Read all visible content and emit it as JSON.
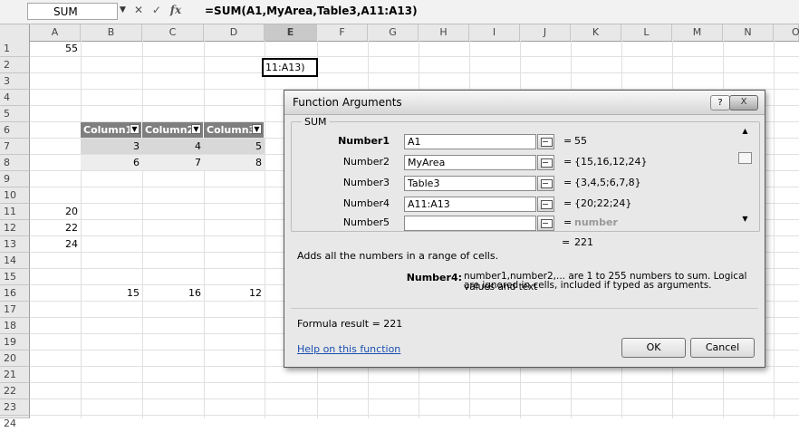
{
  "name_box": "SUM",
  "formula_bar": {
    "cancel_glyph": "✕",
    "enter_glyph": "✓",
    "fx_label": "fx",
    "formula": "=SUM(A1,MyArea,Table3,A11:A13)"
  },
  "columns": [
    "A",
    "B",
    "C",
    "D",
    "E",
    "F",
    "G",
    "H",
    "I",
    "J",
    "K",
    "L",
    "M",
    "N",
    "O"
  ],
  "rows": [
    "1",
    "2",
    "3",
    "4",
    "5",
    "6",
    "7",
    "8",
    "9",
    "10",
    "11",
    "12",
    "13",
    "14",
    "15",
    "16",
    "17",
    "18",
    "19",
    "20",
    "21",
    "22",
    "23",
    "24"
  ],
  "cells": {
    "A1": "55",
    "E2_edit": "11:A13)",
    "A11": "20",
    "A12": "22",
    "A13": "24",
    "B16": "15",
    "C16": "16",
    "D16": "12"
  },
  "table": {
    "headers": [
      "Column1",
      "Column2",
      "Column3"
    ],
    "rows": [
      [
        "3",
        "4",
        "5"
      ],
      [
        "6",
        "7",
        "8"
      ]
    ]
  },
  "dialog": {
    "title": "Function Arguments",
    "help_glyph": "?",
    "close_glyph": "X",
    "function_name": "SUM",
    "args": [
      {
        "label": "Number1",
        "value": "A1",
        "result": "55"
      },
      {
        "label": "Number2",
        "value": "MyArea",
        "result": "{15,16,12,24}"
      },
      {
        "label": "Number3",
        "value": "Table3",
        "result": "{3,4,5;6,7,8}"
      },
      {
        "label": "Number4",
        "value": "A11:A13",
        "result": "{20;22;24}"
      },
      {
        "label": "Number5",
        "value": "",
        "result": "number"
      }
    ],
    "equals": "=",
    "total": "221",
    "description": "Adds all the numbers in a range of cells.",
    "arg_name": "Number4:",
    "arg_desc_line1": "number1,number2,... are 1 to 255 numbers to sum. Logical values and text",
    "arg_desc_line2": "are ignored in cells, included if typed as arguments.",
    "formula_result": "Formula result =  221",
    "help_link": "Help on this function",
    "ok_label": "OK",
    "cancel_label": "Cancel"
  }
}
